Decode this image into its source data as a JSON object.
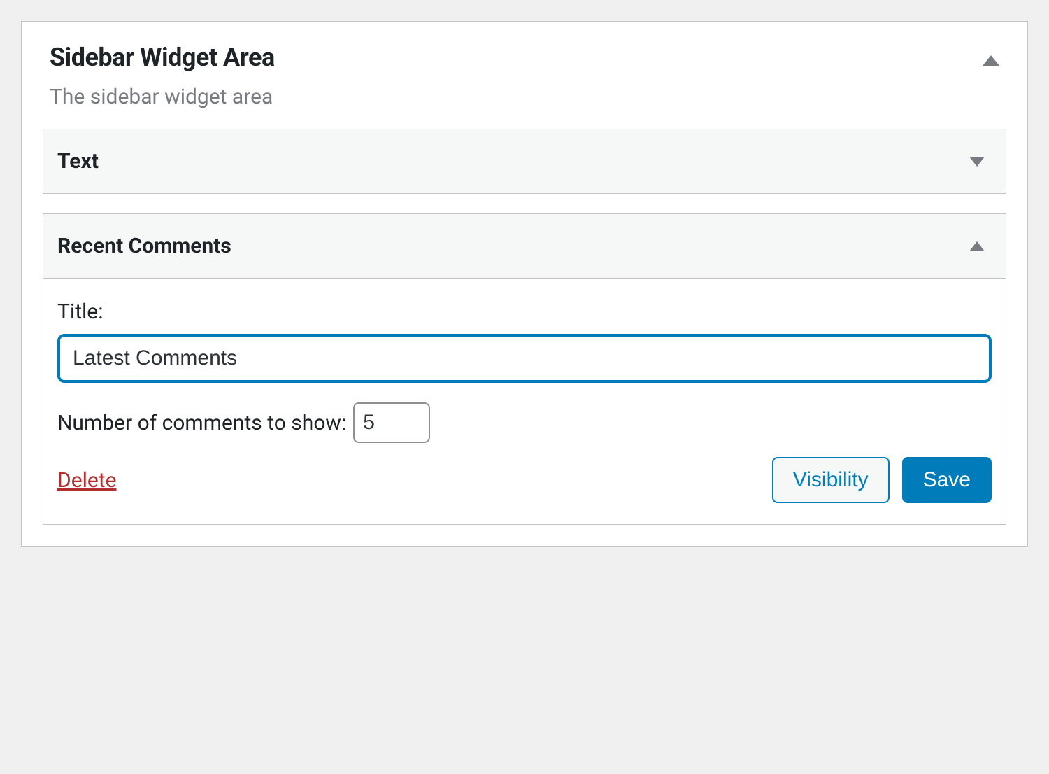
{
  "panel": {
    "title": "Sidebar Widget Area",
    "description": "The sidebar widget area"
  },
  "widgets": {
    "text": {
      "title": "Text"
    },
    "recent_comments": {
      "title": "Recent Comments",
      "form": {
        "title_label": "Title:",
        "title_value": "Latest Comments",
        "count_label": "Number of comments to show:",
        "count_value": "5"
      },
      "actions": {
        "delete": "Delete",
        "visibility": "Visibility",
        "save": "Save"
      }
    }
  }
}
